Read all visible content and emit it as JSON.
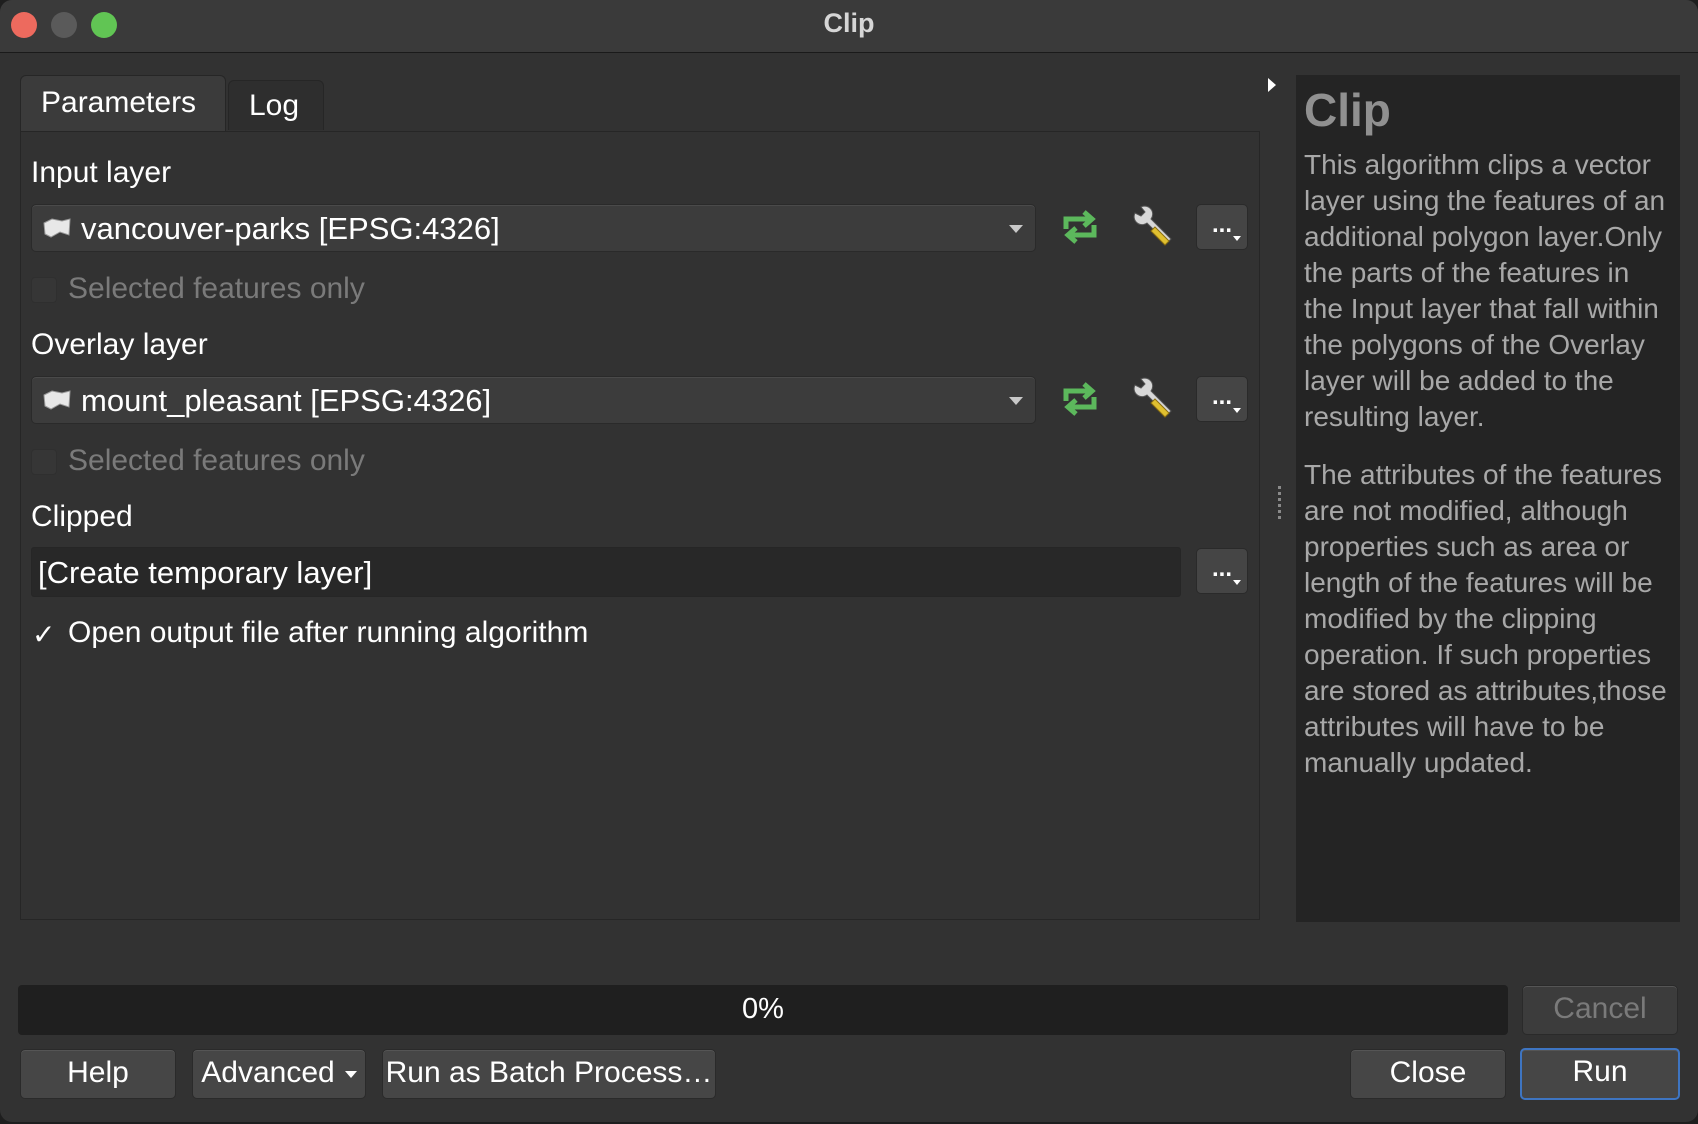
{
  "window": {
    "title": "Clip"
  },
  "tabs": [
    {
      "label": "Parameters",
      "active": true
    },
    {
      "label": "Log",
      "active": false
    }
  ],
  "params": {
    "input_layer": {
      "label": "Input layer",
      "value": "vancouver-parks [EPSG:4326]",
      "selected_only_label": "Selected features only",
      "selected_only_checked": false
    },
    "overlay_layer": {
      "label": "Overlay layer",
      "value": "mount_pleasant [EPSG:4326]",
      "selected_only_label": "Selected features only",
      "selected_only_checked": false
    },
    "clipped": {
      "label": "Clipped",
      "value": "[Create temporary layer]"
    },
    "open_output": {
      "label": "Open output file after running algorithm",
      "checked": true,
      "check_glyph": "✓"
    },
    "dots_label": "..."
  },
  "help": {
    "title": "Clip",
    "paragraphs": [
      "This algorithm clips a vector layer using the features of an additional polygon layer.Only the parts of the features in the Input layer that fall within the polygons of the Overlay layer will be added to the resulting layer.",
      "The attributes of the features are not modified, although properties such as area or length of the features will be modified by the clipping operation. If such properties are stored as attributes,those attributes will have to be manually updated."
    ]
  },
  "progress": {
    "text": "0%",
    "value": 0
  },
  "buttons": {
    "cancel": "Cancel",
    "help": "Help",
    "advanced": "Advanced",
    "batch": "Run as Batch Process…",
    "close": "Close",
    "run": "Run"
  },
  "colors": {
    "iterate_icon": "#5cb85c",
    "wrench_handle": "#e0c030",
    "default_button_border": "#3e75c2"
  }
}
